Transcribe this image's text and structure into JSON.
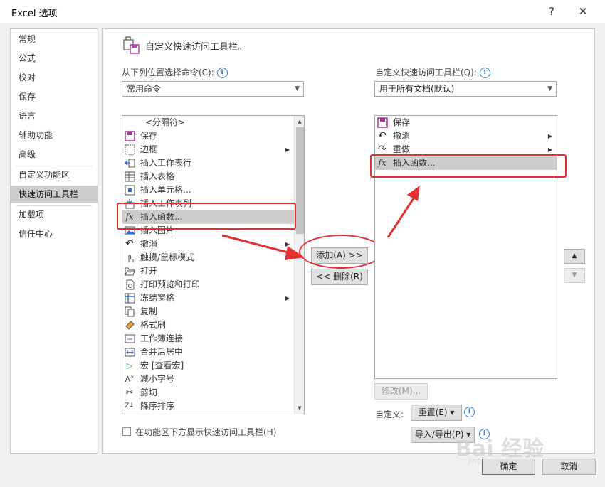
{
  "window": {
    "title": "Excel 选项",
    "help_label": "?",
    "close_label": "✕"
  },
  "nav": {
    "items": [
      {
        "label": "常规"
      },
      {
        "label": "公式"
      },
      {
        "label": "校对"
      },
      {
        "label": "保存"
      },
      {
        "label": "语言"
      },
      {
        "label": "辅助功能"
      },
      {
        "label": "高级"
      },
      {
        "label": "自定义功能区"
      },
      {
        "label": "快速访问工具栏",
        "selected": true
      },
      {
        "label": "加载项"
      },
      {
        "label": "信任中心"
      }
    ]
  },
  "header": {
    "title": "自定义快速访问工具栏。"
  },
  "left": {
    "choose_label": "从下列位置选择命令(C):",
    "choose_value": "常用命令",
    "commands": [
      {
        "label": "<分隔符>",
        "icon": "separator"
      },
      {
        "label": "保存",
        "icon": "save-icon"
      },
      {
        "label": "边框",
        "icon": "border-icon",
        "submenu": true
      },
      {
        "label": "插入工作表行",
        "icon": "insert-row-icon"
      },
      {
        "label": "插入表格",
        "icon": "insert-table-icon"
      },
      {
        "label": "插入单元格...",
        "icon": "insert-cell-icon"
      },
      {
        "label": "插入工作表列",
        "icon": "insert-column-icon"
      },
      {
        "label": "插入函数...",
        "icon": "function-icon",
        "selected": true
      },
      {
        "label": "插入图片",
        "icon": "picture-icon"
      },
      {
        "label": "撤消",
        "icon": "undo-icon",
        "submenu": true
      },
      {
        "label": "触摸/鼠标模式",
        "icon": "touch-mode-icon",
        "submenu": true
      },
      {
        "label": "打开",
        "icon": "open-icon"
      },
      {
        "label": "打印预览和打印",
        "icon": "print-preview-icon"
      },
      {
        "label": "冻结窗格",
        "icon": "freeze-panes-icon",
        "submenu": true
      },
      {
        "label": "复制",
        "icon": "copy-icon"
      },
      {
        "label": "格式刷",
        "icon": "format-painter-icon"
      },
      {
        "label": "工作簿连接",
        "icon": "connections-icon"
      },
      {
        "label": "合并后居中",
        "icon": "merge-center-icon"
      },
      {
        "label": "宏 [查看宏]",
        "icon": "macro-icon"
      },
      {
        "label": "减小字号",
        "icon": "decrease-font-icon"
      },
      {
        "label": "剪切",
        "icon": "cut-icon"
      },
      {
        "label": "降序排序",
        "icon": "sort-desc-icon"
      }
    ],
    "show_below_label": "在功能区下方显示快速访问工具栏(H)"
  },
  "middle": {
    "add_label": "添加(A) >>",
    "remove_label": "<< 删除(R)"
  },
  "right": {
    "customize_label": "自定义快速访问工具栏(Q):",
    "customize_value": "用于所有文档(默认)",
    "items": [
      {
        "label": "保存",
        "icon": "save-icon"
      },
      {
        "label": "撤消",
        "icon": "undo-icon",
        "submenu": true
      },
      {
        "label": "重做",
        "icon": "redo-icon",
        "submenu": true
      },
      {
        "label": "插入函数...",
        "icon": "function-icon",
        "selected": true
      }
    ],
    "modify_label": "修改(M)...",
    "customization_label": "自定义:",
    "reset_label": "重置(E) ▾",
    "import_export_label": "导入/导出(P) ▾"
  },
  "footer": {
    "ok_label": "确定",
    "cancel_label": "取消"
  },
  "watermark": {
    "text": "Bai 经验",
    "sub": "jingyan.baidu.com"
  },
  "colors": {
    "accent_red": "#e53030",
    "info_blue": "#2b7bd1",
    "selection_gray": "#cdcdcd"
  }
}
